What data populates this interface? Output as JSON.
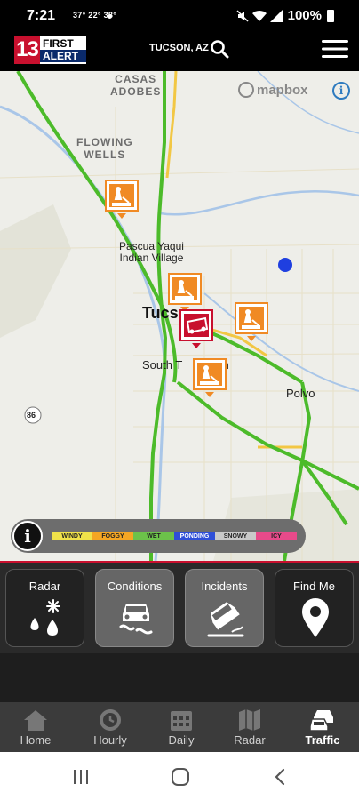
{
  "status_bar": {
    "time": "7:21",
    "temps": "37° 22° 38°",
    "battery": "100%",
    "icons": [
      "mute-icon",
      "wifi-icon",
      "signal-icon",
      "battery-icon"
    ]
  },
  "header": {
    "logo_number": "13",
    "logo_line1": "FIRST",
    "logo_line2": "ALERT",
    "location": "TUCSON, AZ",
    "search_icon": "search-icon",
    "menu_icon": "hamburger-menu-icon"
  },
  "map": {
    "attribution": "mapbox",
    "places": {
      "casas_adobes": "CASAS\nADOBES",
      "flowing_wells": "FLOWING\nWELLS",
      "pascua_yaqui": "Pascua Yaqui\nIndian Village",
      "tucson": "Tucs",
      "south_tucson": "South T",
      "south_tucson_end": "on",
      "polvo": "Polvo",
      "route": "86"
    },
    "markers": [
      {
        "type": "construction",
        "label": "construction-marker"
      },
      {
        "type": "construction",
        "label": "construction-marker"
      },
      {
        "type": "construction",
        "label": "construction-marker"
      },
      {
        "type": "construction",
        "label": "construction-marker"
      },
      {
        "type": "crash",
        "label": "crash-marker"
      }
    ],
    "legend": [
      {
        "label": "WINDY",
        "color": "#f0e24a"
      },
      {
        "label": "FOGGY",
        "color": "#f5a623"
      },
      {
        "label": "WET",
        "color": "#6cc24a"
      },
      {
        "label": "PONDING",
        "color": "#2f4fd8"
      },
      {
        "label": "SNOWY",
        "color": "#c9c9c9"
      },
      {
        "label": "ICY",
        "color": "#e84a8a"
      }
    ]
  },
  "feature_buttons": [
    {
      "label": "Radar",
      "icon": "weather-radar-icon",
      "active": false
    },
    {
      "label": "Conditions",
      "icon": "slippery-road-icon",
      "active": true
    },
    {
      "label": "Incidents",
      "icon": "car-crash-icon",
      "active": true
    },
    {
      "label": "Find Me",
      "icon": "location-pin-icon",
      "active": false
    }
  ],
  "bottom_nav": [
    {
      "label": "Home",
      "icon": "home-icon"
    },
    {
      "label": "Hourly",
      "icon": "clock-icon"
    },
    {
      "label": "Daily",
      "icon": "calendar-icon"
    },
    {
      "label": "Radar",
      "icon": "map-icon"
    },
    {
      "label": "Traffic",
      "icon": "traffic-icon",
      "active": true
    }
  ],
  "colors": {
    "brand_red": "#c8102e",
    "traffic_green": "#4cbb2a",
    "highway_yellow": "#f2c744",
    "river_blue": "#a9c6e8",
    "marker_orange": "#f08a24"
  }
}
